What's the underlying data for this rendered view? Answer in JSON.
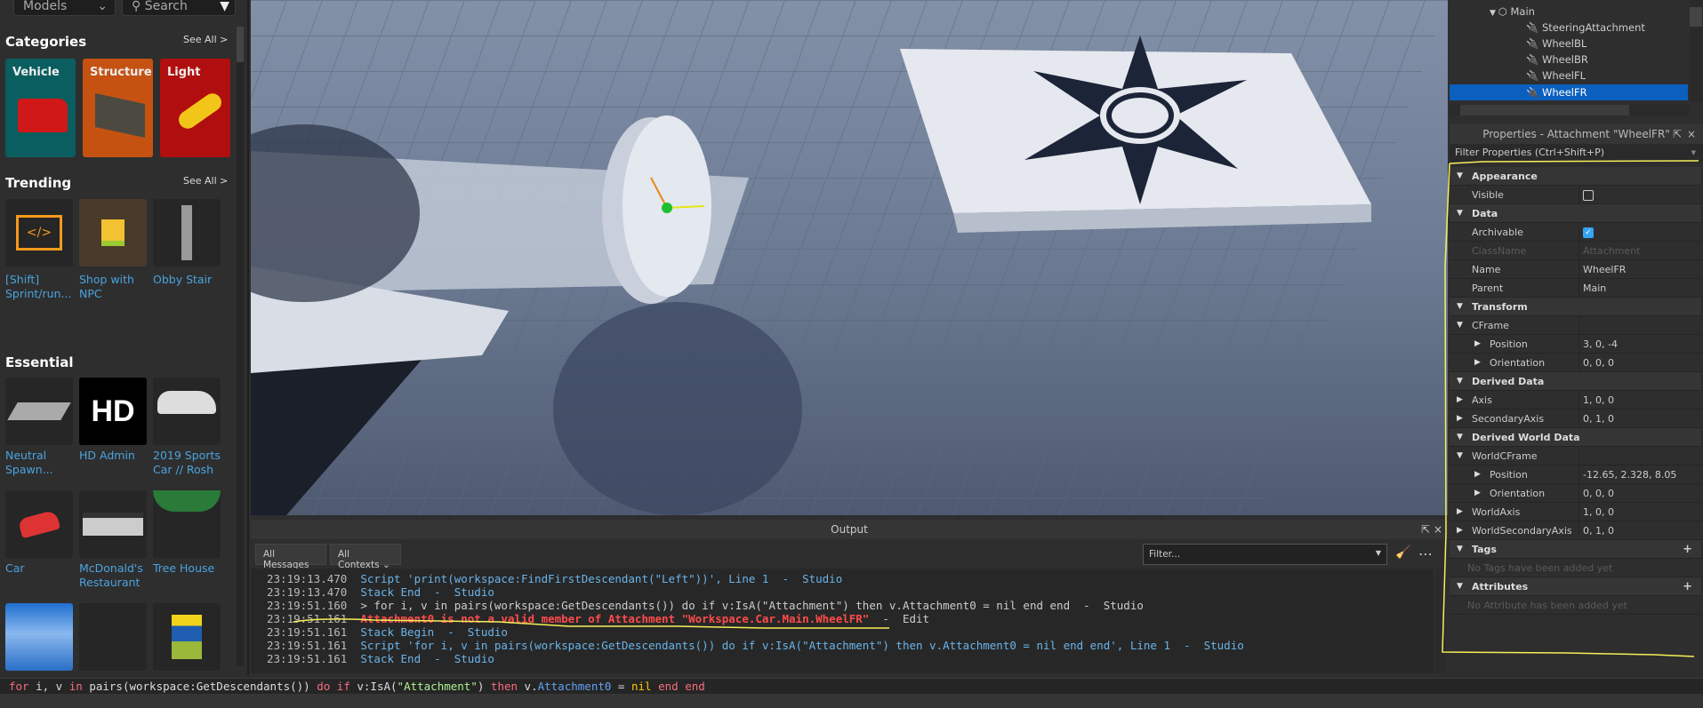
{
  "toolbox": {
    "dropdown": "Models",
    "search_placeholder": "Search",
    "categories": {
      "title": "Categories",
      "see_all": "See All >",
      "items": [
        {
          "label": "Vehicle",
          "color": "#0b5e5f"
        },
        {
          "label": "Structure",
          "color": "#c65212"
        },
        {
          "label": "Light",
          "color": "#b10f0f"
        }
      ]
    },
    "trending": {
      "title": "Trending",
      "see_all": "See All >",
      "items": [
        {
          "label": "[Shift] Sprint/run..."
        },
        {
          "label": "Shop with NPC"
        },
        {
          "label": "Obby Stair"
        }
      ]
    },
    "essential": {
      "title": "Essential",
      "items": [
        {
          "label": "Neutral Spawn..."
        },
        {
          "label": "HD Admin"
        },
        {
          "label": "2019 Sports Car // Rosh"
        },
        {
          "label": "Car"
        },
        {
          "label": "McDonald's Restaurant"
        },
        {
          "label": "Tree House"
        },
        {
          "label": ""
        },
        {
          "label": ""
        },
        {
          "label": ""
        }
      ],
      "hd_logo": "HD"
    }
  },
  "explorer": {
    "items": [
      {
        "label": "Main",
        "icon": "model-icon"
      },
      {
        "label": "SteeringAttachment",
        "icon": "attachment-icon"
      },
      {
        "label": "WheelBL",
        "icon": "attachment-icon"
      },
      {
        "label": "WheelBR",
        "icon": "attachment-icon"
      },
      {
        "label": "WheelFL",
        "icon": "attachment-icon"
      },
      {
        "label": "WheelFR",
        "icon": "attachment-icon",
        "selected": true
      }
    ]
  },
  "properties": {
    "title": "Properties - Attachment \"WheelFR\"",
    "filter_placeholder": "Filter Properties (Ctrl+Shift+P)",
    "appearance": "Appearance",
    "visible": "Visible",
    "data": "Data",
    "archivable": "Archivable",
    "classname": "ClassName",
    "classname_value": "Attachment",
    "name": "Name",
    "name_value": "WheelFR",
    "parent": "Parent",
    "parent_value": "Main",
    "transform": "Transform",
    "cframe": "CFrame",
    "position": "Position",
    "position_value": "3, 0, -4",
    "orientation": "Orientation",
    "orientation_value": "0, 0, 0",
    "derived_data": "Derived Data",
    "axis": "Axis",
    "axis_value": "1, 0, 0",
    "secondary_axis": "SecondaryAxis",
    "secondary_axis_value": "0, 1, 0",
    "derived_world_data": "Derived World Data",
    "world_cframe": "WorldCFrame",
    "world_position_value": "-12.65, 2.328, 8.05",
    "world_orientation_value": "0, 0, 0",
    "world_axis": "WorldAxis",
    "world_axis_value": "1, 0, 0",
    "world_secondary_axis": "WorldSecondaryAxis",
    "world_secondary_axis_value": "0, 1, 0",
    "tags": "Tags",
    "no_tags": "No Tags have been added yet",
    "attributes": "Attributes",
    "no_attributes": "No Attribute has been added yet"
  },
  "output": {
    "title": "Output",
    "messages_filter": "All Messages",
    "contexts_filter": "All Contexts",
    "filter_placeholder": "Filter...",
    "lines": [
      {
        "time": "23:19:13.470",
        "text": "Script 'print(workspace:FindFirstDescendant(\"Left\"))', Line 1  -  Studio",
        "kind": "info"
      },
      {
        "time": "23:19:13.470",
        "text": "Stack End  -  Studio",
        "kind": "info"
      },
      {
        "time": "23:19:51.160",
        "text": "> for i, v in pairs(workspace:GetDescendants()) do if v:IsA(\"Attachment\") then v.Attachment0 = nil end end  -  Studio",
        "kind": "plain"
      },
      {
        "time": "23:19:51.161",
        "text": "Attachment0 is not a valid member of Attachment \"Workspace.Car.Main.WheelFR\"",
        "suffix": "  -  Edit",
        "kind": "err"
      },
      {
        "time": "23:19:51.161",
        "text": "Stack Begin  -  Studio",
        "kind": "info"
      },
      {
        "time": "23:19:51.161",
        "text": "Script 'for i, v in pairs(workspace:GetDescendants()) do if v:IsA(\"Attachment\") then v.Attachment0 = nil end end', Line 1  -  Studio",
        "kind": "info"
      },
      {
        "time": "23:19:51.161",
        "text": "Stack End  -  Studio",
        "kind": "info"
      }
    ]
  },
  "command_bar": {
    "tokens": [
      {
        "t": "for",
        "c": "kw"
      },
      {
        "t": " i, v ",
        "c": ""
      },
      {
        "t": "in",
        "c": "kw"
      },
      {
        "t": " pairs(workspace:GetDescendants()) ",
        "c": ""
      },
      {
        "t": "do",
        "c": "kw"
      },
      {
        "t": " ",
        "c": ""
      },
      {
        "t": "if",
        "c": "kw"
      },
      {
        "t": " v:IsA(",
        "c": ""
      },
      {
        "t": "\"Attachment\"",
        "c": "str"
      },
      {
        "t": ") ",
        "c": ""
      },
      {
        "t": "then",
        "c": "kw"
      },
      {
        "t": " v.",
        "c": ""
      },
      {
        "t": "Attachment0",
        "c": "prop"
      },
      {
        "t": " = ",
        "c": ""
      },
      {
        "t": "nil",
        "c": "nil"
      },
      {
        "t": " ",
        "c": ""
      },
      {
        "t": "end",
        "c": "kw"
      },
      {
        "t": " ",
        "c": ""
      },
      {
        "t": "end",
        "c": "kw"
      }
    ]
  }
}
